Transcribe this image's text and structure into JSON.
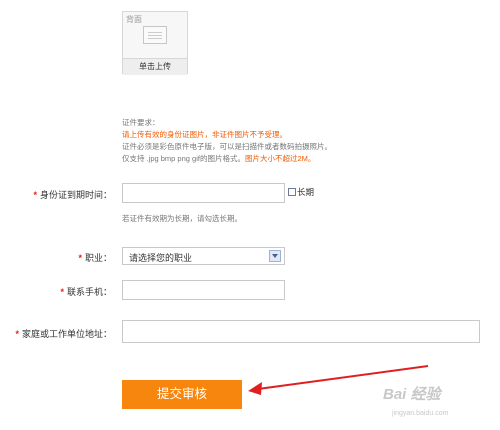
{
  "upload": {
    "back_label": "背面",
    "button_label": "单击上传"
  },
  "requirements": {
    "title": "证件要求：",
    "line1": "请上传有效的身份证图片，非证件图片不予受理。",
    "line2": "证件必须是彩色原件电子版，可以是扫描件或者数码拍摄照片。",
    "line3_prefix": "仅支持 .jpg bmp png gif的图片格式。",
    "line3_red": "图片大小不超过2M。"
  },
  "form": {
    "required_mark": "*",
    "expiry_label": "身份证到期时间：",
    "expiry_value": "",
    "longterm_label": "长期",
    "expiry_hint": "若证件有效期为长期，请勾选长期。",
    "job_label": "职业：",
    "job_selected": "请选择您的职业",
    "phone_label": "联系手机：",
    "phone_value": "",
    "address_label": "家庭或工作单位地址：",
    "address_value": "",
    "submit_label": "提交审核"
  },
  "watermark": {
    "brand": "Bai 经验",
    "url": "jingyan.baidu.com"
  },
  "colors": {
    "accent_orange": "#f7860f",
    "required_red": "#e0221b",
    "warning_text": "#f05a00",
    "annotation_arrow": "#e02020"
  },
  "icons": {
    "id_card": "id-card-icon",
    "dropdown": "chevron-down-icon",
    "arrow": "annotation-arrow"
  }
}
